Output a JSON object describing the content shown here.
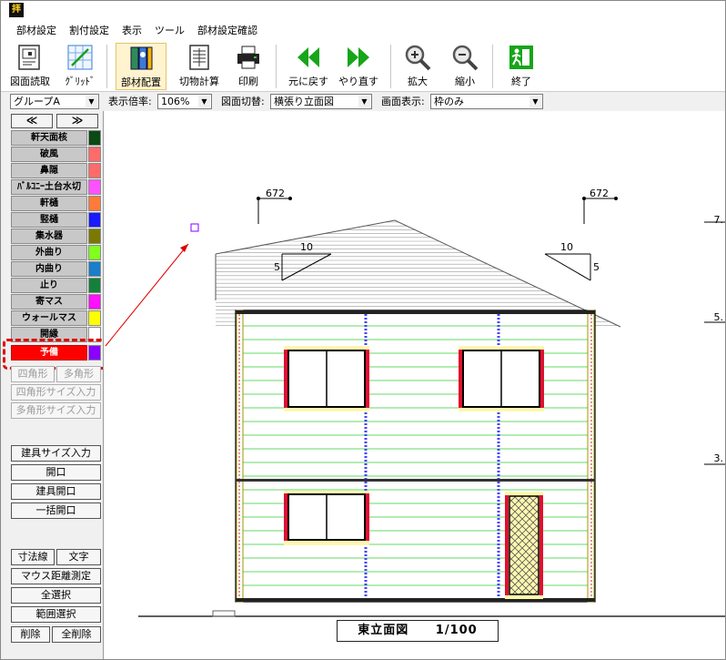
{
  "app": {
    "icon_text": "拝"
  },
  "menu": [
    "部材設定",
    "割付設定",
    "表示",
    "ツール",
    "部材設定確認"
  ],
  "toolbar": {
    "open_drawing": "図面読取",
    "grid": "ｸﾞﾘｯﾄﾞ",
    "place_parts": "部材配置",
    "cut_calc": "切物計算",
    "print": "印刷",
    "undo": "元に戻す",
    "redo": "やり直す",
    "zoom_in": "拡大",
    "zoom_out": "縮小",
    "exit": "終了"
  },
  "options": {
    "group": "グループA",
    "scale_label": "表示倍率:",
    "scale_value": "106%",
    "switch_label": "図面切替:",
    "switch_value": "横張り立面図",
    "display_label": "画面表示:",
    "display_value": "枠のみ"
  },
  "leftpanel": {
    "prev": "≪",
    "next": "≫",
    "parts": [
      {
        "label": "軒天面核",
        "color": "#0b4a14"
      },
      {
        "label": "破風",
        "color": "#ff6b6b"
      },
      {
        "label": "鼻隠",
        "color": "#ff6b6b"
      },
      {
        "label": "ﾊﾞﾙｺﾆｰ土台水切",
        "color": "#ff52ff"
      },
      {
        "label": "軒樋",
        "color": "#ff7b3a"
      },
      {
        "label": "竪樋",
        "color": "#1a1aff"
      },
      {
        "label": "集水器",
        "color": "#7a7a00"
      },
      {
        "label": "外曲り",
        "color": "#80ff20"
      },
      {
        "label": "内曲り",
        "color": "#1a7ec8"
      },
      {
        "label": "止り",
        "color": "#15803d"
      },
      {
        "label": "寄マス",
        "color": "#ff10ff"
      },
      {
        "label": "ウォールマス",
        "color": "#ffff00"
      },
      {
        "label": "開縁",
        "color": "#ffffff"
      },
      {
        "label": "予備",
        "color": "#8b00ff"
      }
    ],
    "shape_buttons": [
      "四角形",
      "多角形",
      "四角形サイズ入力",
      "多角形サイズ入力"
    ],
    "opening_buttons": [
      "建具サイズ入力",
      "開口",
      "建具開口",
      "一括開口"
    ],
    "tool_buttons": [
      "寸法線",
      "文字",
      "マウス距離測定",
      "全選択",
      "範囲選択",
      "削除",
      "全削除"
    ]
  },
  "drawing": {
    "dim_left": "672",
    "dim_right": "672",
    "pitch_left_run": "10",
    "pitch_left_rise": "5",
    "pitch_right_run": "10",
    "pitch_right_rise": "5",
    "edge_marks": [
      "7.",
      "5.",
      "3."
    ],
    "title": "東立面図",
    "scale": "1/100"
  },
  "colors": {
    "selection": "#e00000",
    "siding_line": "#33cc33",
    "downspout": "#6a6aff",
    "window_frame": "#ffee55",
    "window_trim": "#e01030"
  }
}
